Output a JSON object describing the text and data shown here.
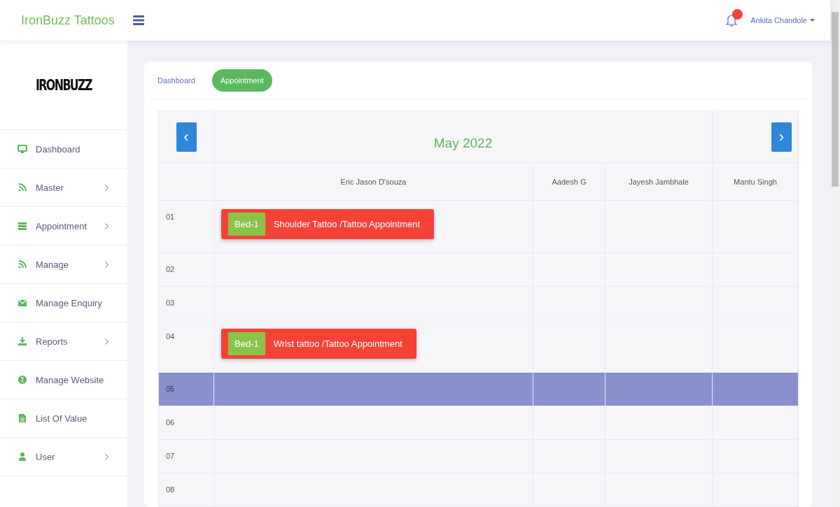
{
  "brand": "IronBuzz Tattoos",
  "user": {
    "name": "Ankita Chandole",
    "has_notification": true
  },
  "sidebar": {
    "logo": "IRONBUZZ",
    "items": [
      {
        "label": "Dashboard",
        "submenu": false
      },
      {
        "label": "Master",
        "submenu": true
      },
      {
        "label": "Appointment",
        "submenu": true
      },
      {
        "label": "Manage",
        "submenu": true
      },
      {
        "label": "Manage Enquiry",
        "submenu": false
      },
      {
        "label": "Reports",
        "submenu": true
      },
      {
        "label": "Manage Website",
        "submenu": false
      },
      {
        "label": "List Of Value",
        "submenu": false
      },
      {
        "label": "User",
        "submenu": true
      }
    ]
  },
  "breadcrumb": [
    {
      "label": "Dashboard",
      "selected": false
    },
    {
      "label": "Appointment",
      "selected": true
    }
  ],
  "calendar": {
    "title": "May 2022",
    "prev": "‹",
    "next": "›",
    "columns": [
      "Eric Jason D'souza",
      "Aadesh G",
      "Jayesh Jambhale",
      "Mantu Singh"
    ],
    "rows": [
      {
        "day": "01",
        "selected": false,
        "cells": [
          [
            {
              "bed": "Bed-1",
              "title": "Shoulder Tattoo /Tattoo Appointment"
            }
          ],
          [],
          [],
          []
        ]
      },
      {
        "day": "02",
        "selected": false,
        "cells": [
          [],
          [],
          [],
          []
        ]
      },
      {
        "day": "03",
        "selected": false,
        "cells": [
          [],
          [],
          [],
          []
        ]
      },
      {
        "day": "04",
        "selected": false,
        "cells": [
          [
            {
              "bed": "Bed-1",
              "title": "Wrist tattoo /Tattoo Appointment"
            }
          ],
          [],
          [],
          []
        ]
      },
      {
        "day": "05",
        "selected": true,
        "cells": [
          [],
          [],
          [],
          []
        ]
      },
      {
        "day": "06",
        "selected": false,
        "cells": [
          [],
          [],
          [],
          []
        ]
      },
      {
        "day": "07",
        "selected": false,
        "cells": [
          [],
          [],
          [],
          []
        ]
      },
      {
        "day": "08",
        "selected": false,
        "cells": [
          [],
          [],
          [],
          []
        ]
      }
    ]
  }
}
